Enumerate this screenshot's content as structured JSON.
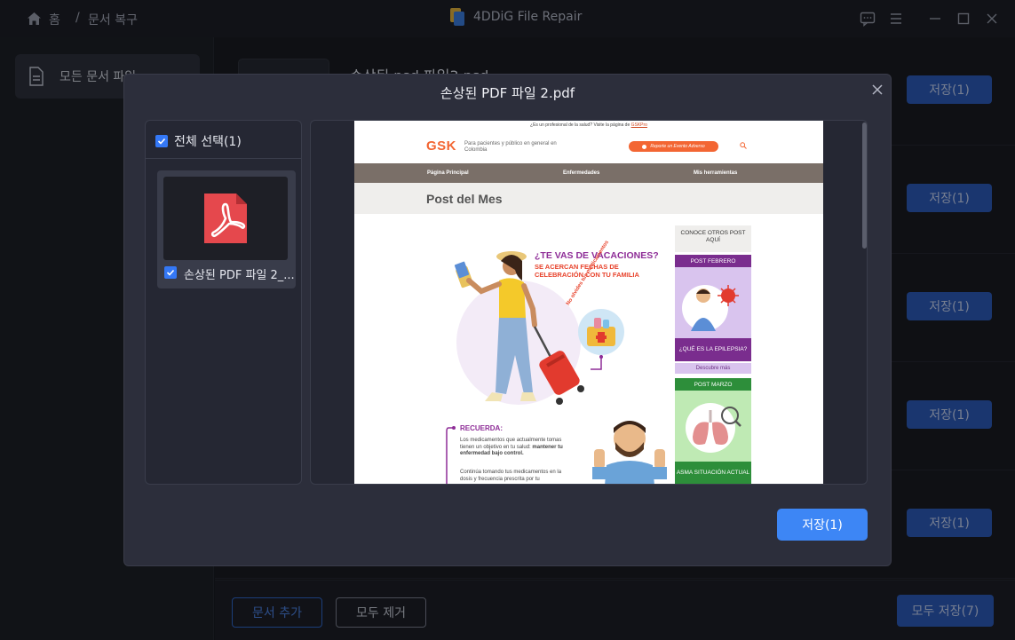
{
  "titlebar": {
    "home_label": "홈",
    "separator": "/",
    "crumb_current": "문서 복구",
    "app_name": "4DDiG File Repair"
  },
  "sidebar": {
    "items": [
      {
        "label": "모든 문서 파일"
      }
    ]
  },
  "file_list": {
    "first_file_name": "손상된 psd 파일3.psd",
    "rows": [
      {
        "save_label": "저장(1)"
      },
      {
        "save_label": "저장(1)"
      },
      {
        "save_label": "저장(1)"
      },
      {
        "save_label": "저장(1)"
      },
      {
        "save_label": "저장(1)"
      }
    ]
  },
  "bottom": {
    "add_label": "문서 추가",
    "remove_label": "모두 제거",
    "save_all_label": "모두 저장(7)"
  },
  "modal": {
    "title": "손상된 PDF 파일 2.pdf",
    "select_all_label": "전체 선택(1)",
    "file_name": "손상된 PDF 파일 2_...",
    "save_label": "저장(1)",
    "primary_color": "#3d86f5"
  },
  "pdf_page": {
    "top_text": "¿Es un profesional de la salud? Visite la página de",
    "top_link": "GSKPro",
    "logo": "GSK",
    "tagline": "Para pacientes y público en general en Colombia",
    "report_button": "Reporte un Evento Adverso",
    "nav": [
      "Página Principal",
      "Enfermedades",
      "Mis herramientas"
    ],
    "section_title": "Post del Mes",
    "headline": "¿TE VAS DE VACACIONES?",
    "subheadline_1": "SE ACERCAN FECHAS DE",
    "subheadline_2": "CELEBRACIÓN CON TU FAMILIA",
    "badge_text": "No olvides tus medicamentos",
    "recuerda": "RECUERDA:",
    "body_1_a": "Los medicamentos que actualmente tomas tienen un objetivo en tu salud:",
    "body_1_b": "mantener tu enfermedad bajo control.",
    "body_2": "Continúa tomando tus medicamentos en la dosis y frecuencia prescrita por tu",
    "side_header": "CONOCE OTROS POST AQUÍ",
    "post_feb": "POST FEBRERO",
    "epilepsia": "¿QUÉ ES LA EPILEPSIA?",
    "descubre": "Descubre más",
    "post_mar": "POST MARZO",
    "asma": "ASMA SITUACIÓN ACTUAL"
  }
}
